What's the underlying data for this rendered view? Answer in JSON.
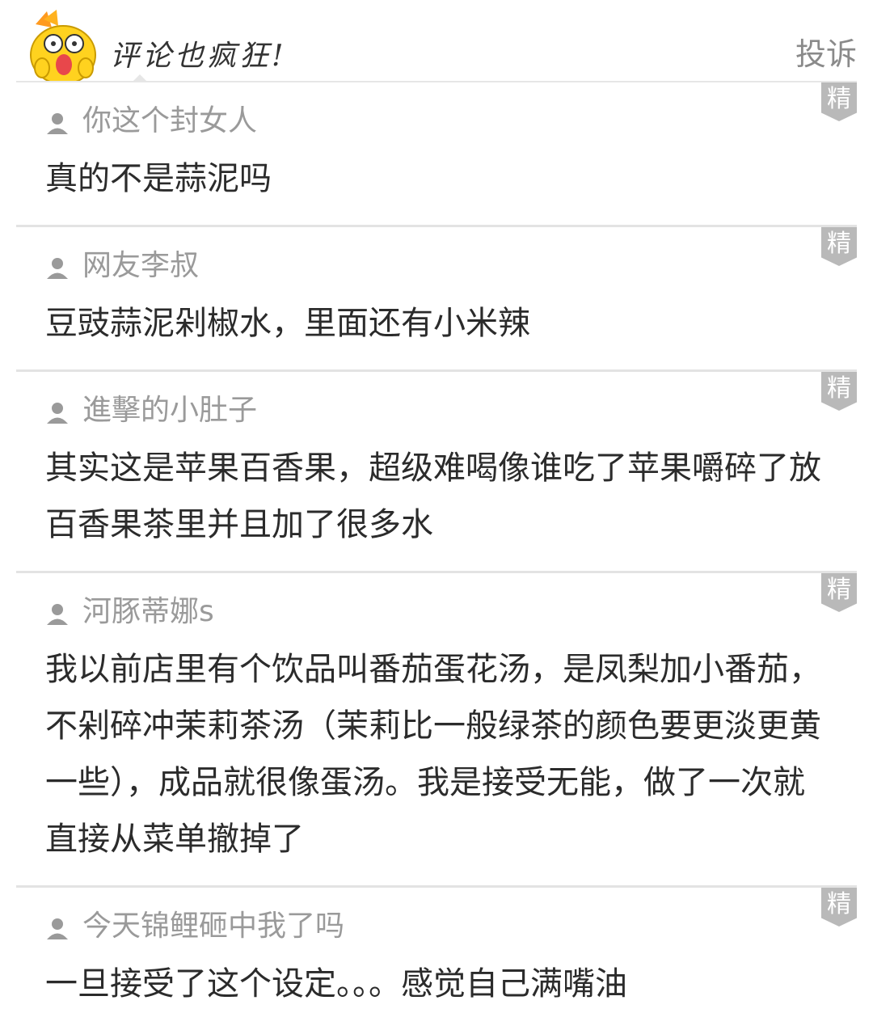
{
  "header": {
    "title": "评论也疯狂!",
    "report_label": "投诉"
  },
  "badge_label": "精",
  "comments": [
    {
      "username": "你这个封女人",
      "text": "真的不是蒜泥吗"
    },
    {
      "username": "网友李叔",
      "text": "豆豉蒜泥剁椒水，里面还有小米辣"
    },
    {
      "username": "進擊的小肚子",
      "text": "其实这是苹果百香果，超级难喝像谁吃了苹果嚼碎了放百香果茶里并且加了很多水"
    },
    {
      "username": "河豚蒂娜s",
      "text": "我以前店里有个饮品叫番茄蛋花汤，是凤梨加小番茄，不剁碎冲茉莉茶汤（茉莉比一般绿茶的颜色要更淡更黄一些），成品就很像蛋汤。我是接受无能，做了一次就直接从菜单撤掉了"
    },
    {
      "username": "今天锦鲤砸中我了吗",
      "text": "一旦接受了这个设定。。。感觉自己满嘴油"
    }
  ]
}
